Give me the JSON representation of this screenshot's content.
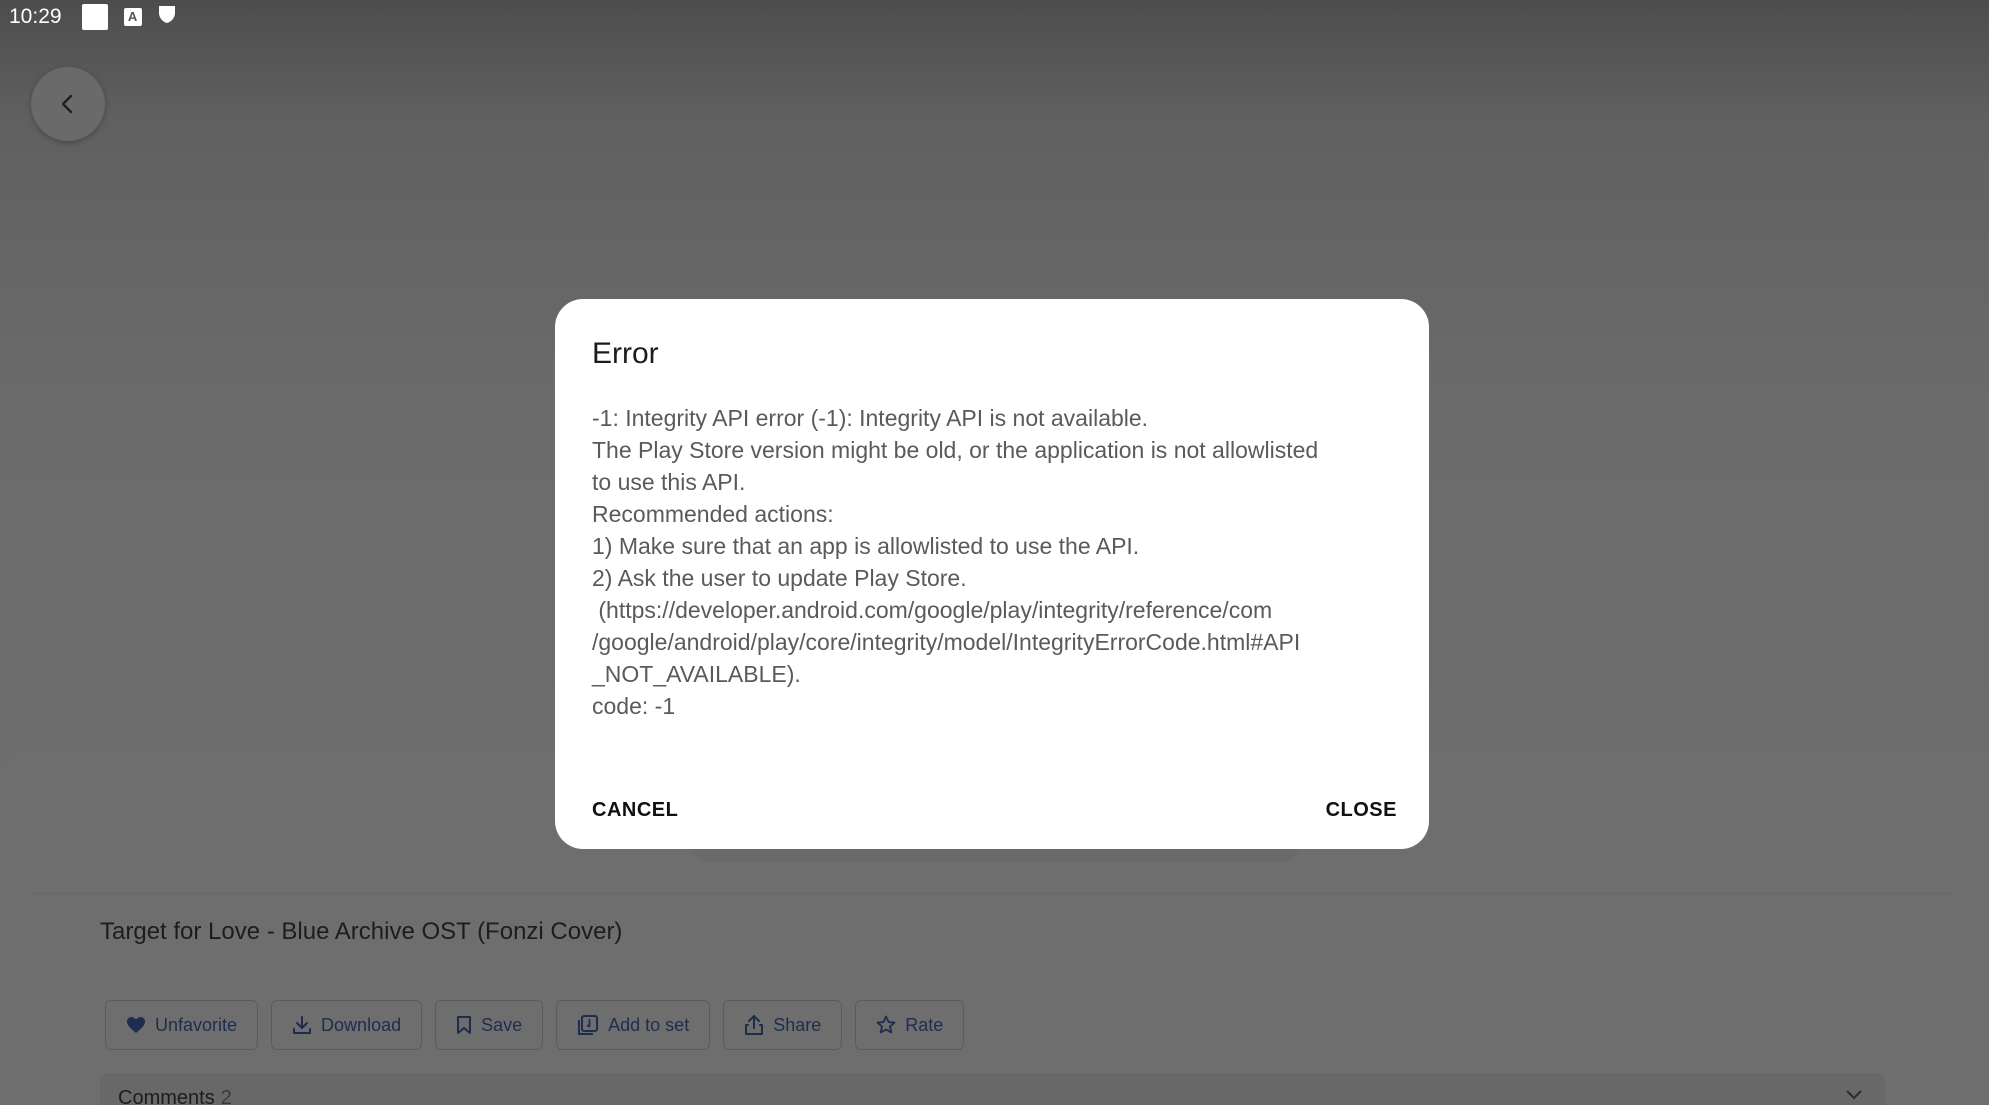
{
  "status_bar": {
    "time": "10:29",
    "icons": [
      "notification-square-icon",
      "font-a-icon",
      "shield-icon"
    ],
    "a_glyph": "A"
  },
  "background": {
    "track_title": "Target for Love - Blue Archive OST (Fonzi Cover)",
    "actions": [
      {
        "label": "Unfavorite",
        "icon": "heart-icon"
      },
      {
        "label": "Download",
        "icon": "download-icon"
      },
      {
        "label": "Save",
        "icon": "bookmark-icon"
      },
      {
        "label": "Add to set",
        "icon": "playlist-add-icon"
      },
      {
        "label": "Share",
        "icon": "share-icon"
      },
      {
        "label": "Rate",
        "icon": "star-icon"
      }
    ],
    "comments": {
      "label": "Comments",
      "count": "2"
    }
  },
  "dialog": {
    "title": "Error",
    "message_lines": [
      "-1: Integrity API error (-1): Integrity API is not available.",
      "The Play Store version might be old, or the application is not allowlisted",
      "to use this API.",
      "Recommended actions:",
      "1) Make sure that an app is allowlisted to use the API.",
      "2) Ask the user to update Play Store.",
      " (https://developer.android.com/google/play/integrity/reference/com",
      "/google/android/play/core/integrity/model/IntegrityErrorCode.html#API",
      "_NOT_AVAILABLE).",
      "code: -1"
    ],
    "cancel_label": "CANCEL",
    "close_label": "CLOSE"
  },
  "colors": {
    "scrim": "#6b6b6b",
    "dialog_bg": "#ffffff",
    "action_text": "#1e2d4f"
  }
}
